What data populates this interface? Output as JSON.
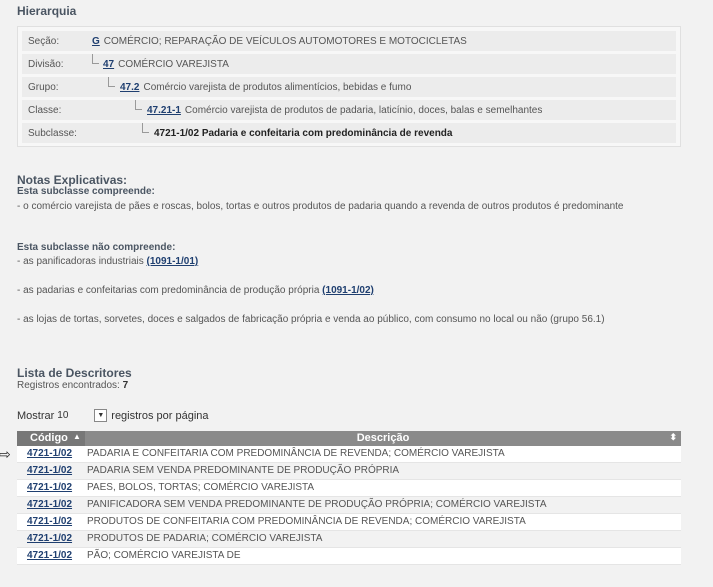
{
  "hierarquia": {
    "title": "Hierarquia",
    "rows": [
      {
        "label": "Seção:",
        "code": "G",
        "text": "COMÉRCIO; REPARAÇÃO DE VEÍCULOS AUTOMOTORES E MOTOCICLETAS"
      },
      {
        "label": "Divisão:",
        "code": "47",
        "text": "COMÉRCIO VAREJISTA"
      },
      {
        "label": "Grupo:",
        "code": "47.2",
        "text": "Comércio varejista de produtos alimentícios, bebidas e fumo"
      },
      {
        "label": "Classe:",
        "code": "47.21-1",
        "text": "Comércio varejista de produtos de padaria, laticínio, doces, balas e semelhantes"
      },
      {
        "label": "Subclasse:",
        "text": "4721-1/02 Padaria e confeitaria com predominância de revenda"
      }
    ]
  },
  "notas": {
    "title": "Notas Explicativas:",
    "compreende_title": "Esta subclasse compreende:",
    "compreende": "- o comércio varejista de pães e roscas, bolos, tortas e outros produtos de padaria quando a revenda de outros produtos é predominante",
    "nao_title": "Esta subclasse não compreende:",
    "nao": [
      {
        "text": "- as panificadoras industriais ",
        "link": "(1091-1/01)"
      },
      {
        "text": "- as padarias e confeitarias com predominância de produção própria ",
        "link": "(1091-1/02)"
      },
      {
        "text": "- as lojas de tortas, sorvetes, doces e salgados de fabricação própria e venda ao público, com consumo no local ou não (grupo 56.1)",
        "link": ""
      }
    ]
  },
  "descritores": {
    "title": "Lista de Descritores",
    "count_label": "Registros encontrados: ",
    "count": "7",
    "show_before": "Mostrar",
    "show_value": "10",
    "show_after": "registros por página",
    "col_code": "Código",
    "col_desc": "Descrição",
    "rows": [
      {
        "code": "4721-1/02",
        "desc": "PADARIA E CONFEITARIA COM PREDOMINÂNCIA DE REVENDA; COMÉRCIO VAREJISTA"
      },
      {
        "code": "4721-1/02",
        "desc": "PADARIA SEM VENDA PREDOMINANTE DE PRODUÇÃO PRÓPRIA"
      },
      {
        "code": "4721-1/02",
        "desc": "PAES, BOLOS, TORTAS; COMÉRCIO VAREJISTA"
      },
      {
        "code": "4721-1/02",
        "desc": "PANIFICADORA SEM VENDA PREDOMINANTE DE PRODUÇÃO PRÓPRIA; COMÉRCIO VAREJISTA"
      },
      {
        "code": "4721-1/02",
        "desc": "PRODUTOS DE CONFEITARIA COM PREDOMINÂNCIA DE REVENDA; COMÉRCIO VAREJISTA"
      },
      {
        "code": "4721-1/02",
        "desc": "PRODUTOS DE PADARIA; COMÉRCIO VAREJISTA"
      },
      {
        "code": "4721-1/02",
        "desc": "PÃO; COMÉRCIO VAREJISTA DE"
      }
    ]
  }
}
